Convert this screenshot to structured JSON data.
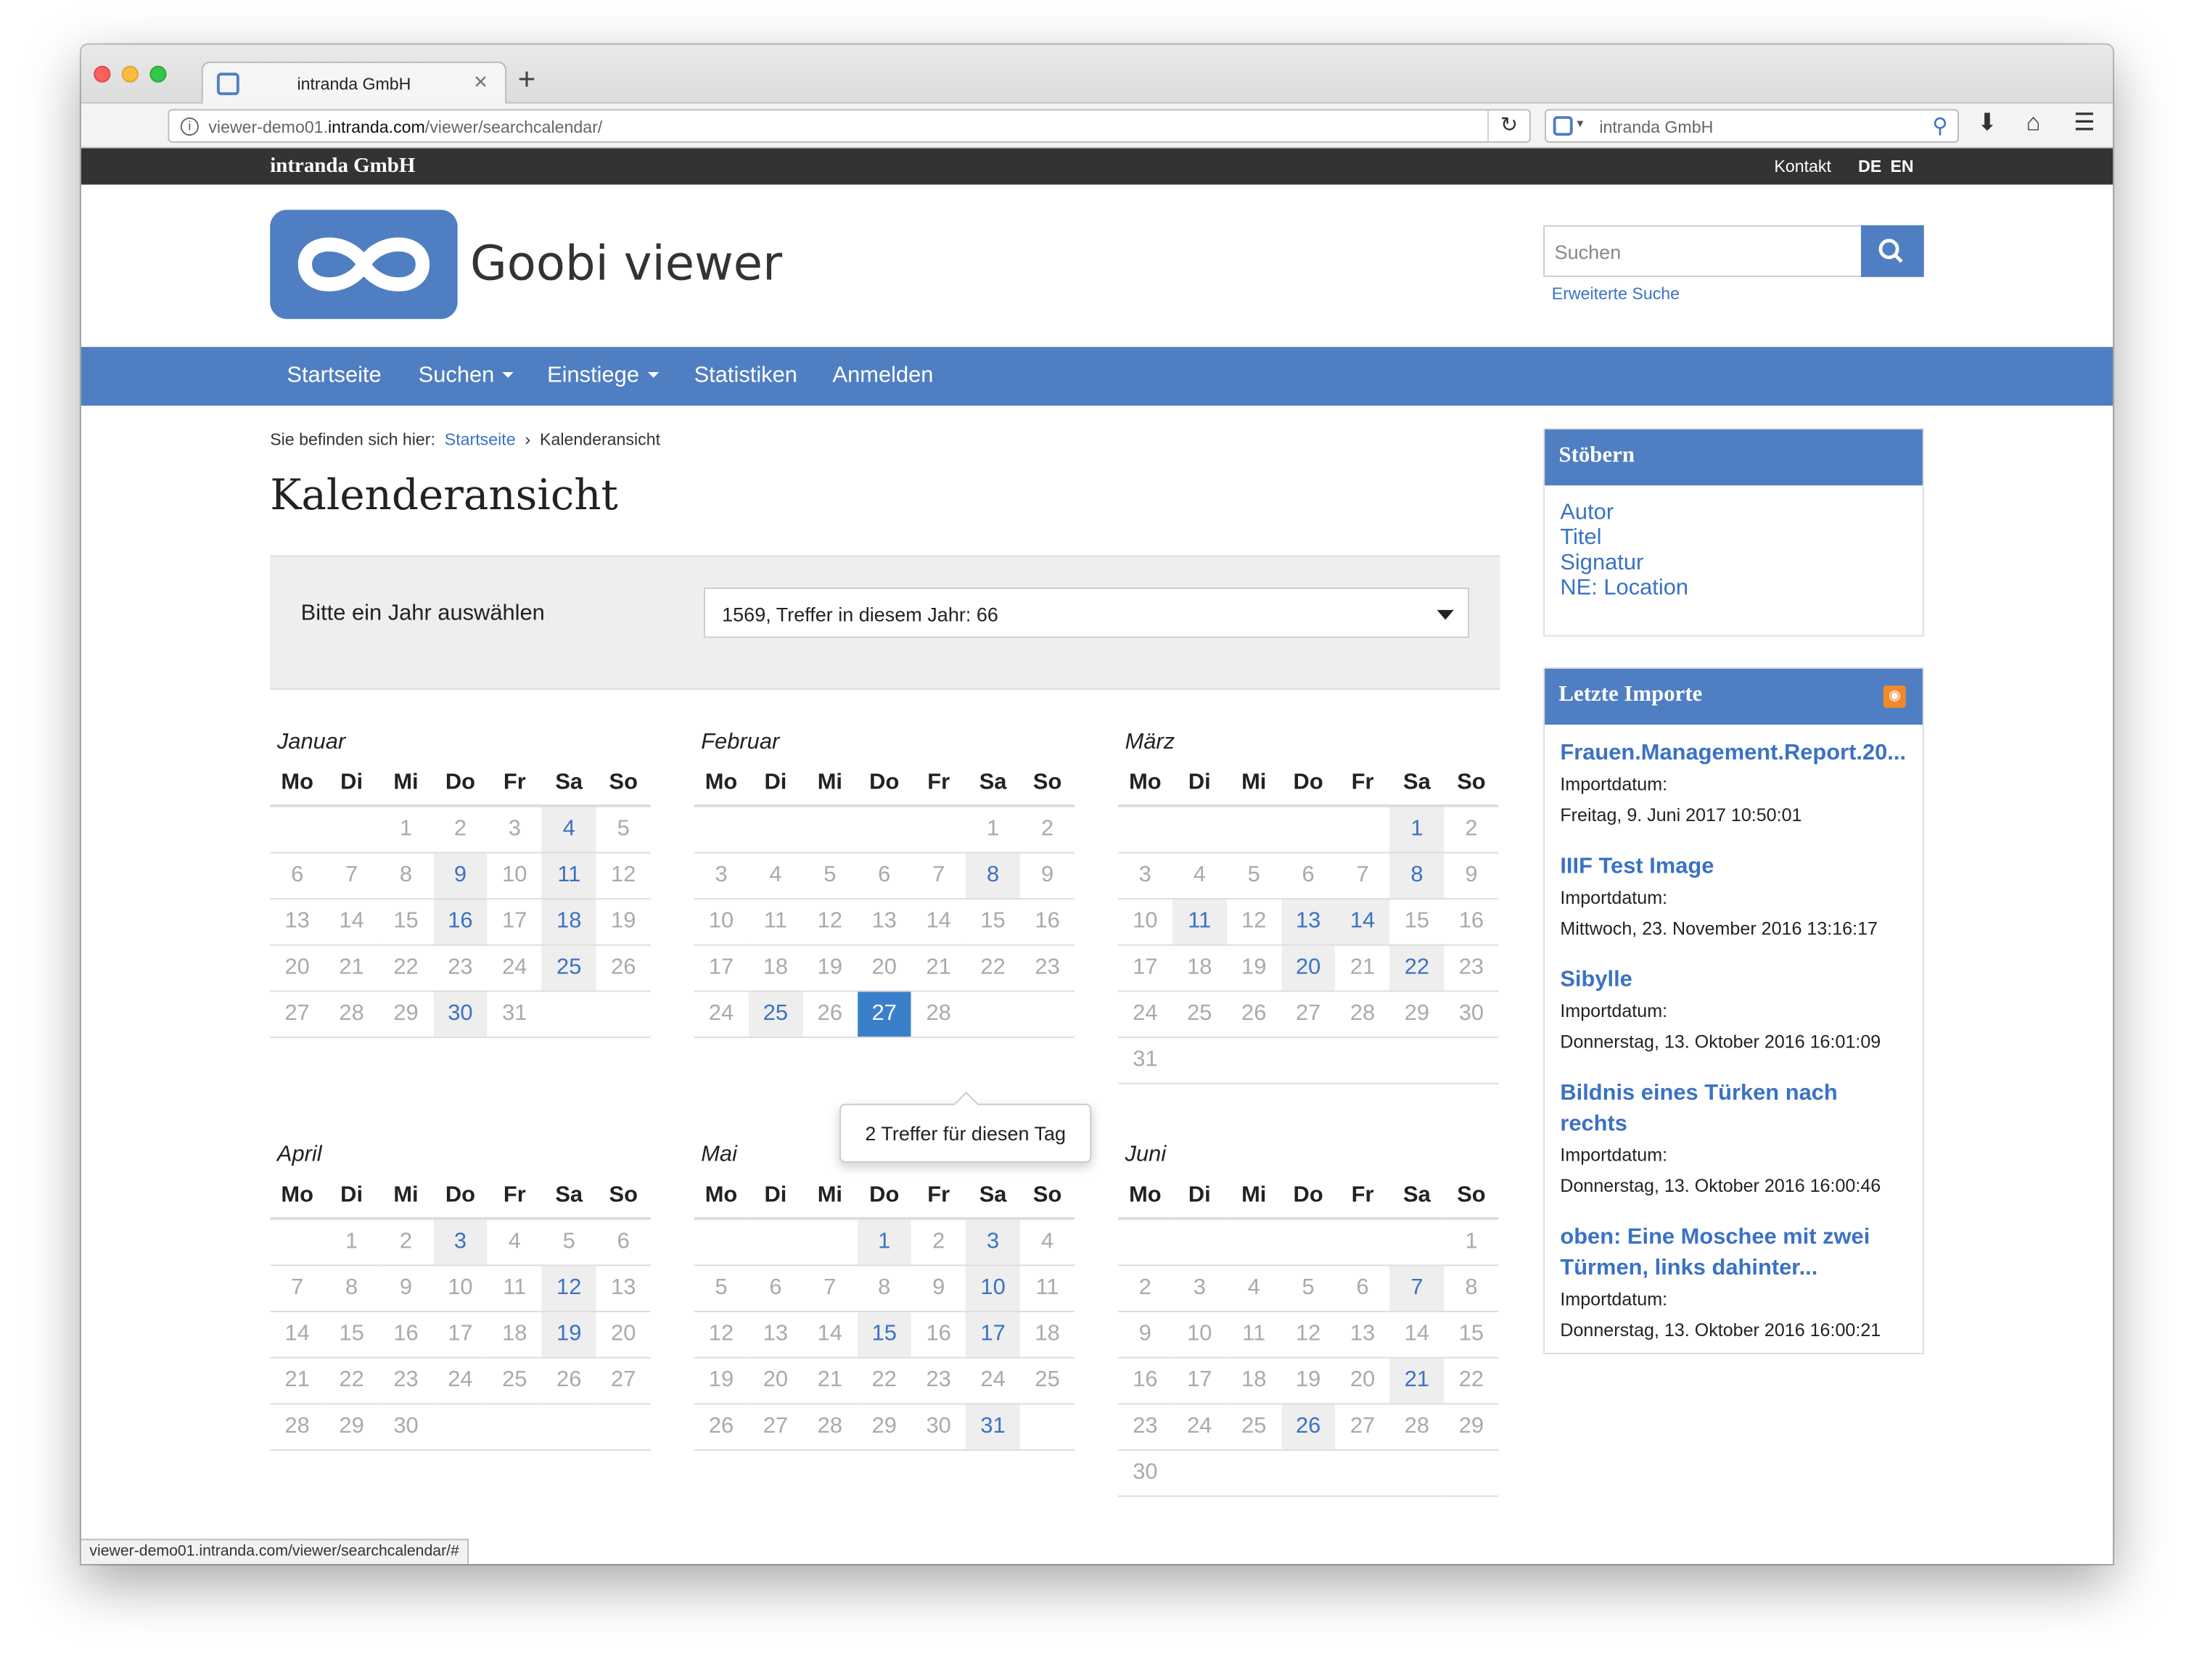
{
  "browser": {
    "tab_title": "intranda GmbH",
    "url_prefix": "viewer-demo01.",
    "url_domain": "intranda.com",
    "url_path": "/viewer/searchcalendar/",
    "search_engine": "intranda GmbH",
    "status_url": "viewer-demo01.intranda.com/viewer/searchcalendar/#"
  },
  "topbar": {
    "brand": "intranda GmbH",
    "contact": "Kontakt",
    "lang_de": "DE",
    "lang_en": "EN"
  },
  "header": {
    "logo_text": "Goobi viewer",
    "search_placeholder": "Suchen",
    "advanced_search": "Erweiterte Suche"
  },
  "nav": {
    "items": [
      "Startseite",
      "Suchen",
      "Einstiege",
      "Statistiken",
      "Anmelden"
    ]
  },
  "breadcrumb": {
    "prefix": "Sie befinden sich hier:",
    "home": "Startseite",
    "sep": "›",
    "current": "Kalenderansicht"
  },
  "page_title": "Kalenderansicht",
  "year_select": {
    "label": "Bitte ein Jahr auswählen",
    "value": "1569, Treffer in diesem Jahr: 66"
  },
  "weekdays": [
    "Mo",
    "Di",
    "Mi",
    "Do",
    "Fr",
    "Sa",
    "So"
  ],
  "months": [
    {
      "name": "Januar",
      "offset": 2,
      "days": 31,
      "hits": [
        4,
        9,
        11,
        16,
        18,
        25,
        30
      ],
      "active": null
    },
    {
      "name": "Februar",
      "offset": 5,
      "days": 28,
      "hits": [
        8,
        25,
        27
      ],
      "active": 27
    },
    {
      "name": "März",
      "offset": 5,
      "days": 31,
      "hits": [
        1,
        8,
        11,
        13,
        14,
        20,
        22
      ],
      "active": null
    },
    {
      "name": "April",
      "offset": 1,
      "days": 30,
      "hits": [
        3,
        12,
        19
      ],
      "active": null
    },
    {
      "name": "Mai",
      "offset": 3,
      "days": 31,
      "hits": [
        1,
        3,
        10,
        15,
        17,
        31
      ],
      "active": null
    },
    {
      "name": "Juni",
      "offset": 6,
      "days": 30,
      "hits": [
        7,
        21,
        26
      ],
      "active": null
    }
  ],
  "tooltip": "2 Treffer für diesen Tag",
  "sidebar": {
    "browse_title": "Stöbern",
    "browse_links": [
      "Autor",
      "Titel",
      "Signatur",
      "NE: Location"
    ],
    "imports_title": "Letzte Importe",
    "imports": [
      {
        "title": "Frauen.Management.Report.20...",
        "label": "Importdatum:",
        "date": "Freitag, 9. Juni 2017 10:50:01"
      },
      {
        "title": "IIIF Test Image",
        "label": "Importdatum:",
        "date": "Mittwoch, 23. November 2016 13:16:17"
      },
      {
        "title": "Sibylle",
        "label": "Importdatum:",
        "date": "Donnerstag, 13. Oktober 2016 16:01:09"
      },
      {
        "title": "Bildnis eines Türken nach rechts",
        "label": "Importdatum:",
        "date": "Donnerstag, 13. Oktober 2016 16:00:46"
      },
      {
        "title": "oben: Eine Moschee mit zwei Türmen, links dahinter...",
        "label": "Importdatum:",
        "date": "Donnerstag, 13. Oktober 2016 16:00:21"
      }
    ]
  },
  "colors": {
    "primary": "#4f7ec2",
    "link": "#3a72c4",
    "active_day": "#3a7fc9",
    "topbar": "#333333"
  }
}
